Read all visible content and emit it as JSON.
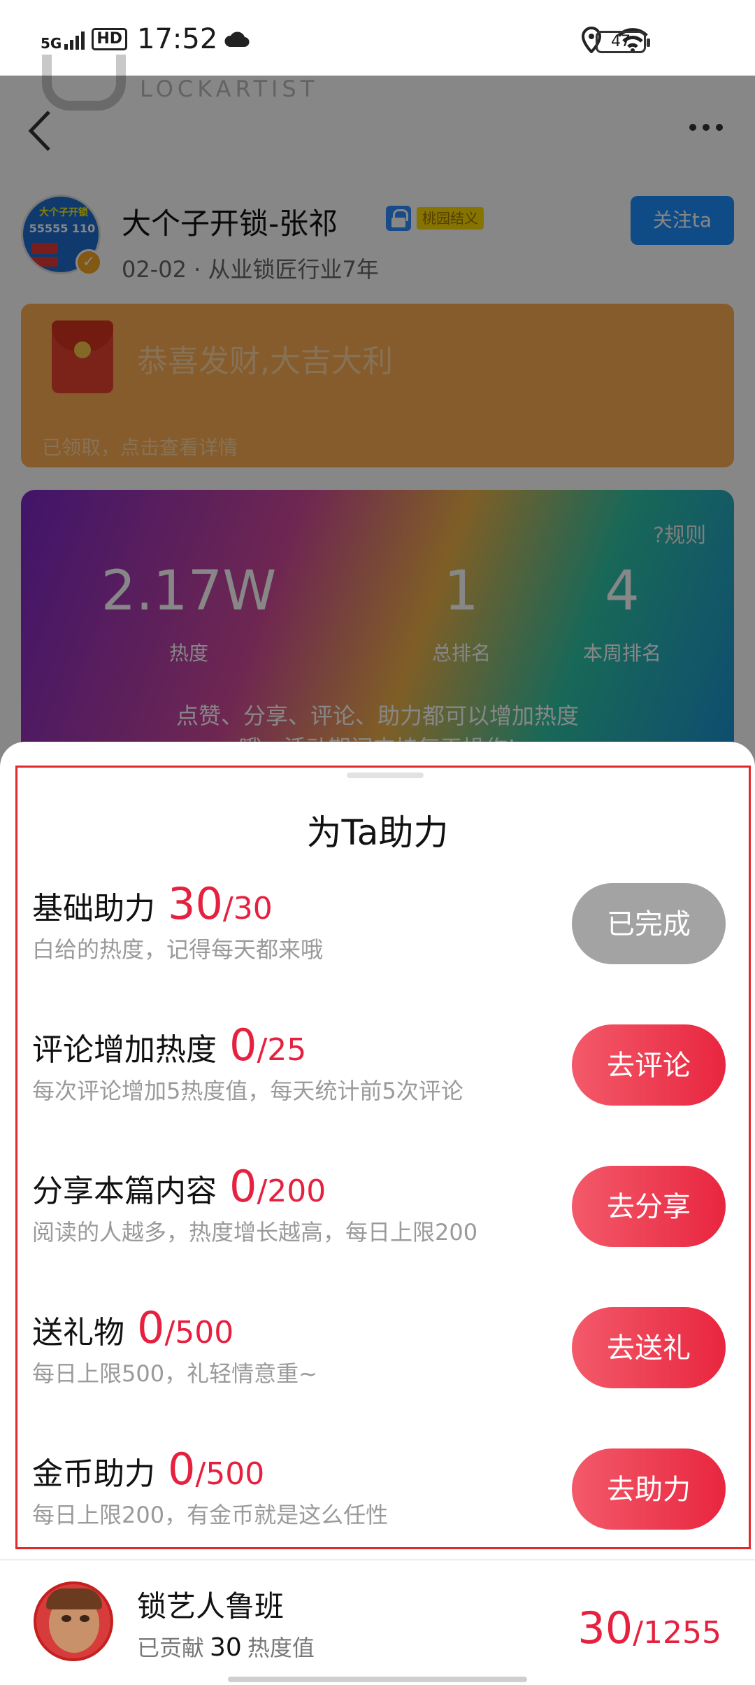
{
  "status_bar": {
    "network": "5G",
    "hd": "HD",
    "time": "17:52",
    "battery": "47"
  },
  "background_page": {
    "watermark": "LOCKARTIST",
    "shop": {
      "name": "大个子开锁-张祁",
      "tag": "桃园结义",
      "meta": "02-02 · 从业锁匠行业7年",
      "follow_label": "关注ta",
      "avatar_text_1": "大个子开锁",
      "avatar_text_2": "55555 110"
    },
    "red_packet": {
      "title": "恭喜发财,大吉大利",
      "subtitle": "已领取，点击查看详情"
    },
    "heat_card": {
      "rule_label": "?规则",
      "stats": [
        {
          "value": "2.17W",
          "label": "热度"
        },
        {
          "value": "1",
          "label": "总排名"
        },
        {
          "value": "4",
          "label": "本周排名"
        }
      ],
      "note_line1": "点赞、分享、评论、助力都可以增加热度",
      "note_line2": "哦，活动期间支持每天操作!"
    }
  },
  "sheet": {
    "title": "为Ta助力",
    "tasks": [
      {
        "name": "基础助力",
        "progress": "30",
        "total": "/30",
        "desc": "白给的热度，记得每天都来哦",
        "button": "已完成",
        "done": true
      },
      {
        "name": "评论增加热度",
        "progress": "0",
        "total": "/25",
        "desc": "每次评论增加5热度值，每天统计前5次评论",
        "button": "去评论",
        "done": false
      },
      {
        "name": "分享本篇内容",
        "progress": "0",
        "total": "/200",
        "desc": "阅读的人越多，热度增长越高，每日上限200",
        "button": "去分享",
        "done": false
      },
      {
        "name": "送礼物",
        "progress": "0",
        "total": "/500",
        "desc": "每日上限500，礼轻情意重~",
        "button": "去送礼",
        "done": false
      },
      {
        "name": "金币助力",
        "progress": "0",
        "total": "/500",
        "desc": "每日上限200，有金币就是这么任性",
        "button": "去助力",
        "done": false
      }
    ]
  },
  "me": {
    "name": "锁艺人鲁班",
    "contributed_prefix": "已贡献",
    "contributed_value": "30",
    "contributed_suffix": "热度值",
    "score": "30",
    "score_total": "/1255"
  },
  "colors": {
    "accent_red": "#e5213f",
    "follow_blue": "#1e90ff",
    "done_gray": "#a3a3a3",
    "highlight_border": "#e12a2a"
  }
}
